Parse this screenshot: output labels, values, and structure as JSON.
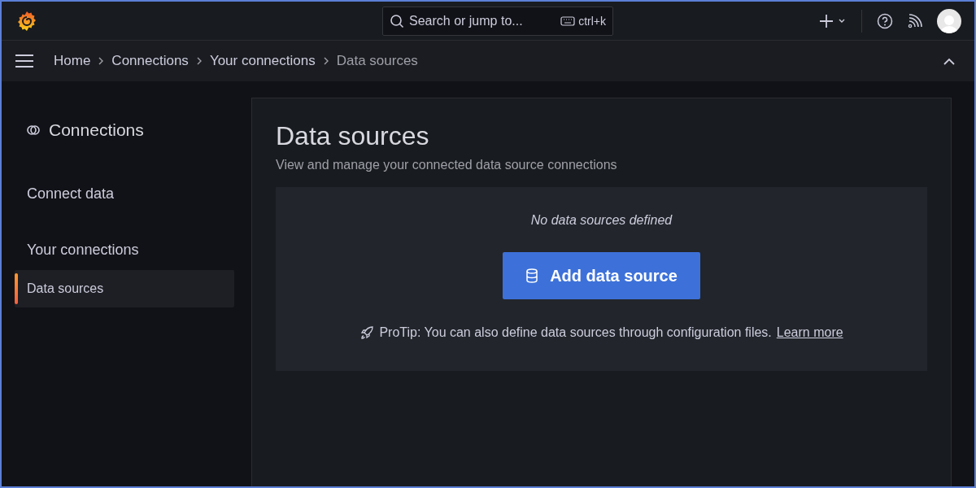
{
  "topbar": {
    "search": {
      "placeholder": "Search or jump to...",
      "shortcut": "ctrl+k"
    }
  },
  "breadcrumbs": [
    {
      "label": "Home",
      "current": false
    },
    {
      "label": "Connections",
      "current": false
    },
    {
      "label": "Your connections",
      "current": false
    },
    {
      "label": "Data sources",
      "current": true
    }
  ],
  "sidebar": {
    "title": "Connections",
    "items": [
      {
        "label": "Connect data",
        "kind": "heading",
        "selected": false
      },
      {
        "label": "Your connections",
        "kind": "heading",
        "selected": false
      },
      {
        "label": "Data sources",
        "kind": "link",
        "selected": true
      }
    ]
  },
  "page": {
    "title": "Data sources",
    "subtitle": "View and manage your connected data source connections",
    "empty_state": {
      "message": "No data sources defined",
      "button": "Add data source",
      "protip": "ProTip: You can also define data sources through configuration files.",
      "link": "Learn more"
    }
  }
}
